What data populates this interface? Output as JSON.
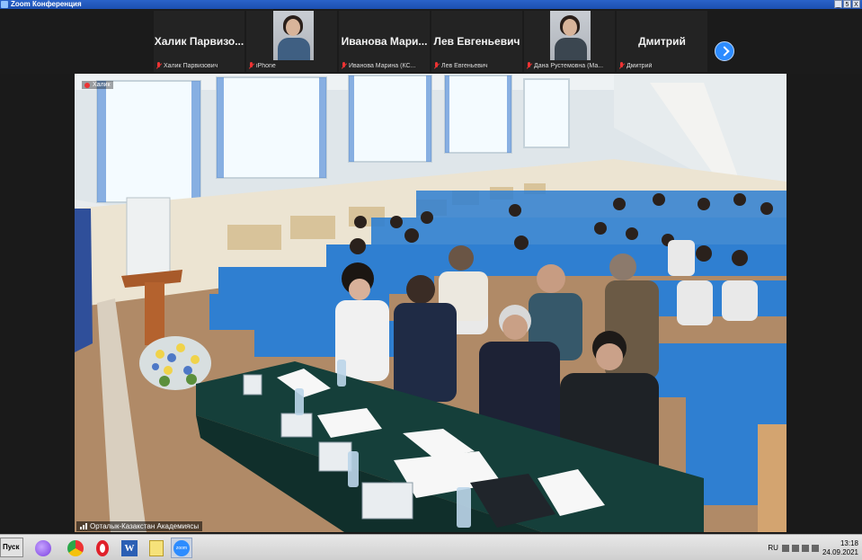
{
  "window": {
    "title": "Zoom Конференция",
    "buttons": [
      "_",
      "5",
      "X"
    ]
  },
  "gallery": {
    "tiles": [
      {
        "name": "Халик  Парвизо...",
        "footer": "Халик Парвизович",
        "video": false
      },
      {
        "name": "",
        "footer": "iPhone",
        "video": true
      },
      {
        "name": "Иванова  Мари...",
        "footer": "Иванова Марина (КС...",
        "video": false
      },
      {
        "name": "Лев Евгеньевич",
        "footer": "Лев Евгеньевич",
        "video": false
      },
      {
        "name": "",
        "footer": "Дана Рустемовна (Ма...",
        "video": true
      },
      {
        "name": "Дмитрий",
        "footer": "Дмитрий",
        "video": false
      }
    ]
  },
  "main_video": {
    "speaker_label": "Орталык-Казакстан Академиясы",
    "top_label": "Халик"
  },
  "taskbar": {
    "start_label": "Пуск",
    "icons": [
      "alice-icon",
      "chrome-icon",
      "opera-icon",
      "word-icon",
      "notes-icon",
      "zoom-icon"
    ],
    "zoom_label": "zoom",
    "lang": "RU",
    "time": "13:18",
    "date": "24.09.2021"
  }
}
